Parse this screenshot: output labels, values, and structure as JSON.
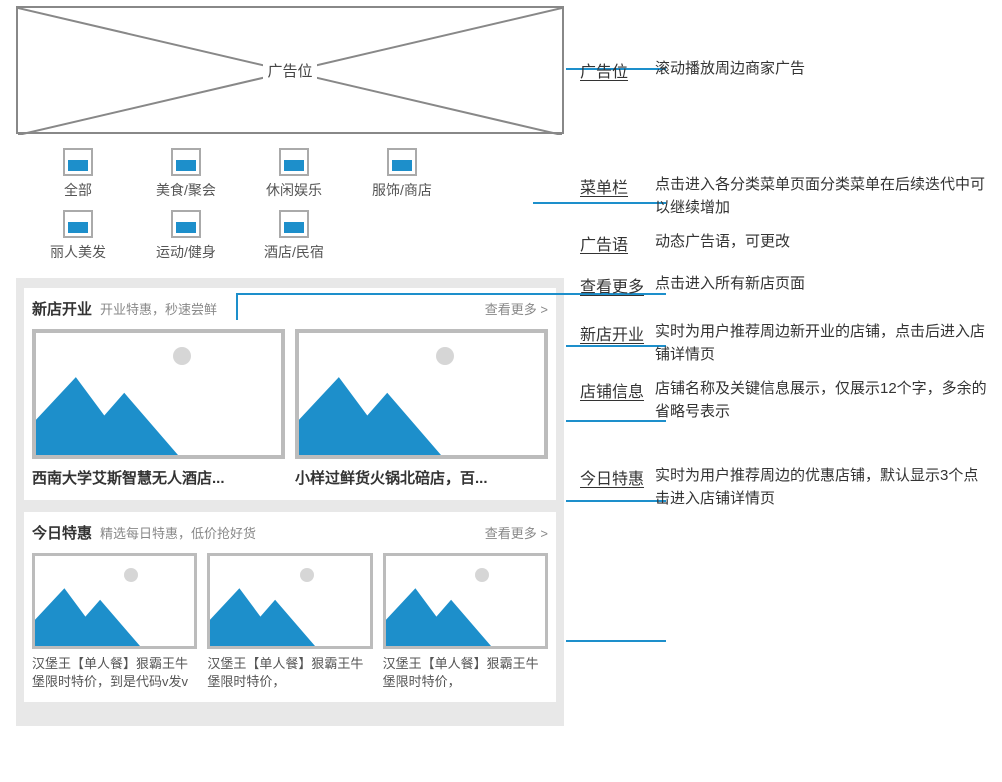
{
  "adslot": {
    "label": "广告位"
  },
  "categories": [
    {
      "label": "全部"
    },
    {
      "label": "美食/聚会"
    },
    {
      "label": "休闲娱乐"
    },
    {
      "label": "服饰/商店"
    },
    {
      "label": "丽人美发"
    },
    {
      "label": "运动/健身"
    },
    {
      "label": "酒店/民宿"
    }
  ],
  "newOpen": {
    "title": "新店开业",
    "subtitle": "开业特惠，秒速尝鲜",
    "more": "查看更多 >",
    "cards": [
      {
        "caption": "西南大学艾斯智慧无人酒店..."
      },
      {
        "caption": "小样过鲜货火锅北碚店，百..."
      }
    ]
  },
  "todayDeal": {
    "title": "今日特惠",
    "subtitle": "精选每日特惠，低价抢好货",
    "more": "查看更多 >",
    "cards": [
      {
        "caption": "汉堡王【单人餐】狠霸王牛堡限时特价，到是代码v发v"
      },
      {
        "caption": "汉堡王【单人餐】狠霸王牛堡限时特价，"
      },
      {
        "caption": "汉堡王【单人餐】狠霸王牛堡限时特价，"
      }
    ]
  },
  "callouts": {
    "ad": {
      "key": "广告位",
      "txt": "滚动播放周边商家广告"
    },
    "menu": {
      "key": "菜单栏",
      "txt": "点击进入各分类菜单页面分类菜单在后续迭代中可以继续增加"
    },
    "slogan": {
      "key": "广告语",
      "txt": "动态广告语，可更改"
    },
    "more": {
      "key": "查看更多",
      "txt": "点击进入所有新店页面"
    },
    "newopen": {
      "key": "新店开业",
      "txt": "实时为用户推荐周边新开业的店铺，点击后进入店铺详情页"
    },
    "shop": {
      "key": "店铺信息",
      "txt": "店铺名称及关键信息展示，仅展示12个字，多余的省略号表示"
    },
    "today": {
      "key": "今日特惠",
      "txt": "实时为用户推荐周边的优惠店铺，默认显示3个点击进入店铺详情页"
    }
  }
}
